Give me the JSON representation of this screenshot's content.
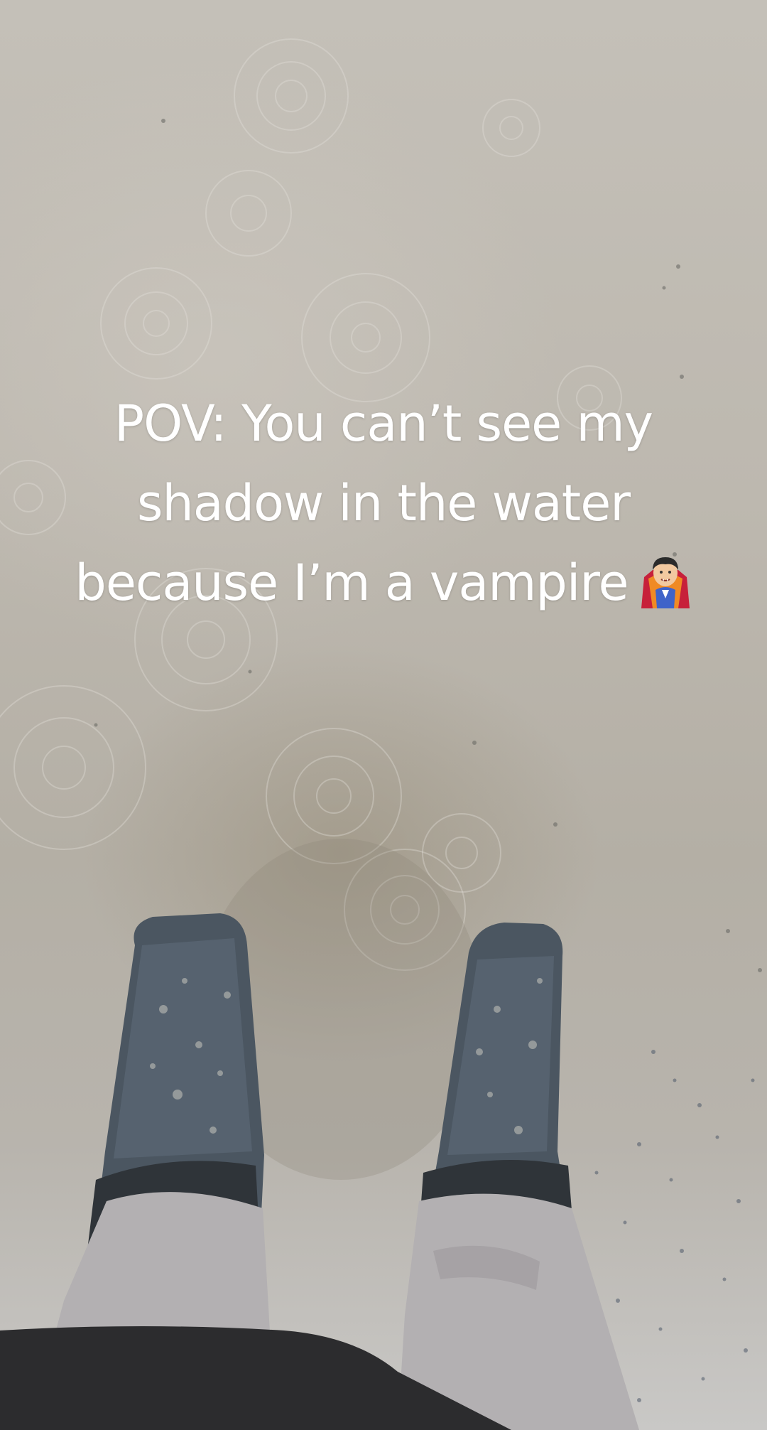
{
  "caption": {
    "line1": "POV: You can’t see my",
    "line2": "shadow in the water",
    "line3": "because I’m a vampire"
  },
  "emoji": {
    "icon": "vampire-emoji",
    "glyph": "🧛"
  },
  "colors": {
    "water": "#bdb8af",
    "text": "#ffffff",
    "boots": "#4a5560",
    "pants": "#b3b0b2",
    "jacket": "#2c2c2e"
  }
}
